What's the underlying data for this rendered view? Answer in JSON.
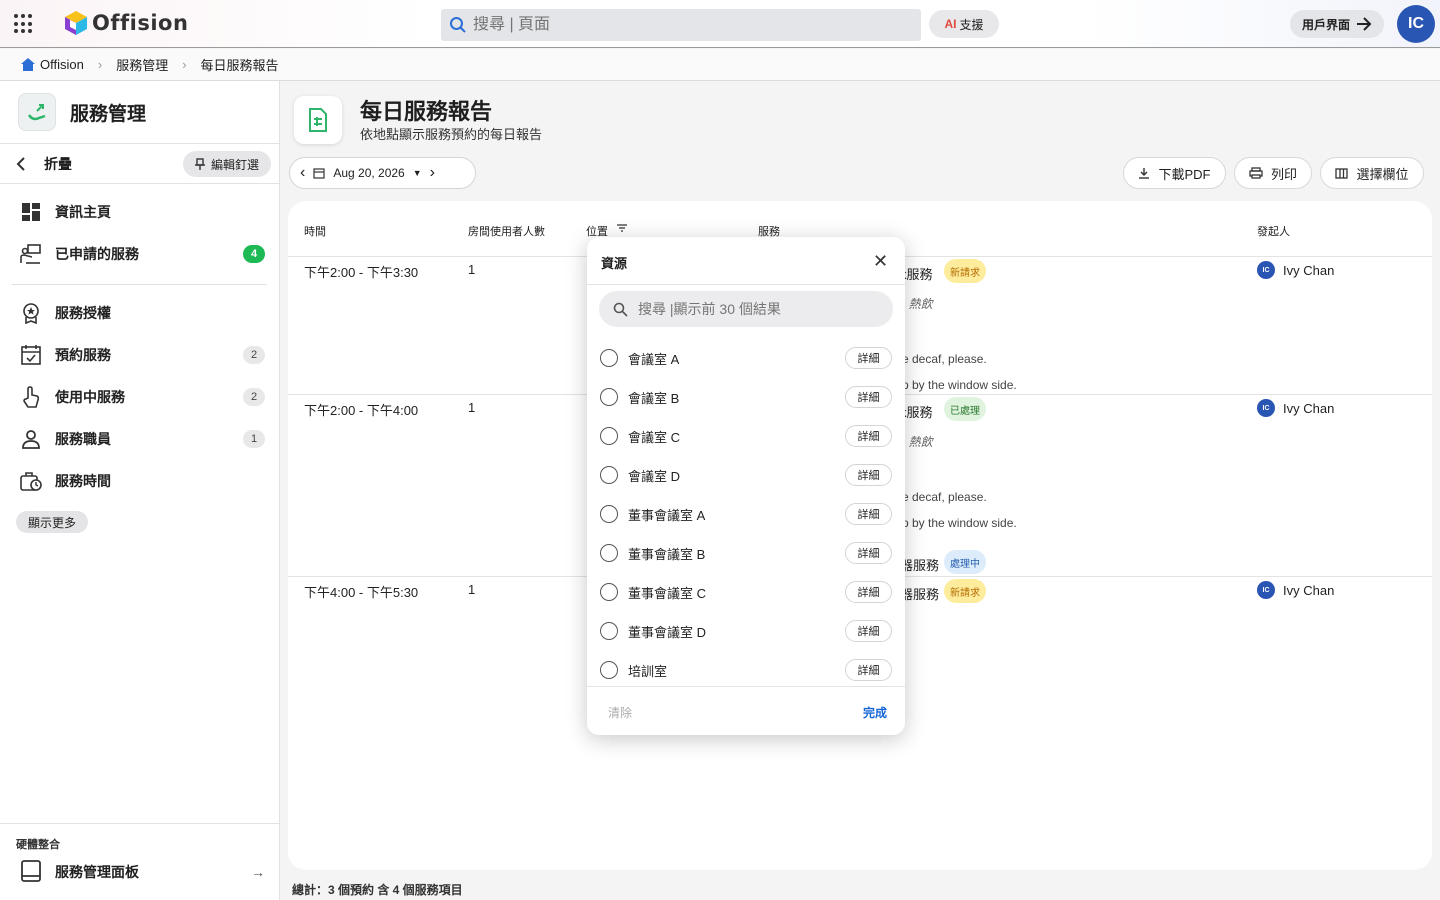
{
  "topbar": {
    "brand": "Offision",
    "search_placeholder": "搜尋 | 頁面",
    "ai_prefix": "AI",
    "ai_label": "支援",
    "user_ui_label": "用戶界面",
    "avatar_initials": "IC"
  },
  "breadcrumb": [
    "Offision",
    "服務管理",
    "每日服務報告"
  ],
  "sidebar": {
    "title": "服務管理",
    "collapse_label": "折疊",
    "pin_label": "編輯釘選",
    "items": [
      {
        "label": "資訊主頁",
        "icon": "dashboard-icon",
        "count": ""
      },
      {
        "label": "已申請的服務",
        "icon": "service-request-icon",
        "count": "4"
      },
      {
        "label": "服務授權",
        "icon": "award-icon",
        "count": ""
      },
      {
        "label": "預約服務",
        "icon": "calendar-check-icon",
        "count": "2"
      },
      {
        "label": "使用中服務",
        "icon": "touch-icon",
        "count": "2"
      },
      {
        "label": "服務職員",
        "icon": "person-icon",
        "count": "1"
      },
      {
        "label": "服務時間",
        "icon": "briefcase-clock-icon",
        "count": ""
      }
    ],
    "more_label": "顯示更多",
    "hardware_label": "硬體整合",
    "hardware_item": "服務管理面板"
  },
  "page": {
    "title": "每日服務報告",
    "subtitle": "依地點顯示服務預約的每日報告",
    "date": "Aug 20, 2026",
    "download_label": "下載PDF",
    "print_label": "列印",
    "columns_label": "選擇欄位"
  },
  "table": {
    "headers": {
      "time": "時間",
      "users": "房間使用者人數",
      "location": "位置",
      "service": "服務",
      "requester": "發起人"
    },
    "rows": [
      {
        "time": "下午2:00 - 下午3:30",
        "users": "1",
        "service": "k服務",
        "status": "新請求",
        "note1": ": 熱飲",
        "note2": "e decaf, please.",
        "note3": "p by the window side.",
        "requester": "Ivy Chan",
        "requester_initials": "IC"
      },
      {
        "time": "下午2:00 - 下午4:00",
        "users": "1",
        "service": "k服務",
        "status": "已處理",
        "note1": ": 熱飲",
        "note2": "e decaf, please.",
        "note3": "p by the window side.",
        "service2": "器服務",
        "status2": "處理中",
        "requester": "Ivy Chan",
        "requester_initials": "IC"
      },
      {
        "time": "下午4:00 - 下午5:30",
        "users": "1",
        "service": "器服務",
        "status": "新請求",
        "requester": "Ivy Chan",
        "requester_initials": "IC"
      }
    ]
  },
  "footer": {
    "total": "總計：3 個預約 含 4 個服務項目"
  },
  "popup": {
    "title": "資源",
    "search_placeholder": "搜尋 |顯示前 30 個結果",
    "detail_label": "詳細",
    "items": [
      "會議室 A",
      "會議室 B",
      "會議室 C",
      "會議室 D",
      "董事會議室 A",
      "董事會議室 B",
      "董事會議室 C",
      "董事會議室 D",
      "培訓室"
    ],
    "clear_label": "清除",
    "done_label": "完成"
  },
  "colors": {
    "accent": "#1766d6",
    "avatar": "#2a56b3",
    "badge_green": "#1db954"
  }
}
